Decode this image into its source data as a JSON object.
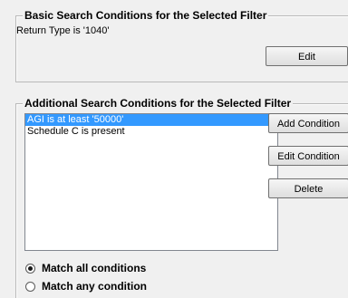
{
  "basic": {
    "title": "Basic Search Conditions for the Selected Filter",
    "condition_text": "Return Type is '1040'",
    "edit_label": "Edit"
  },
  "additional": {
    "title": "Additional Search Conditions for the Selected Filter",
    "conditions": [
      {
        "label": "AGI is at least '50000'",
        "selected": true
      },
      {
        "label": "Schedule C is present",
        "selected": false
      }
    ],
    "add_label": "Add Condition",
    "edit_label": "Edit Condition",
    "delete_label": "Delete"
  },
  "match": {
    "all_label": "Match all conditions",
    "any_label": "Match any condition",
    "selected": "all"
  },
  "colors": {
    "selection": "#3399ff",
    "background": "#f0f0f0"
  }
}
